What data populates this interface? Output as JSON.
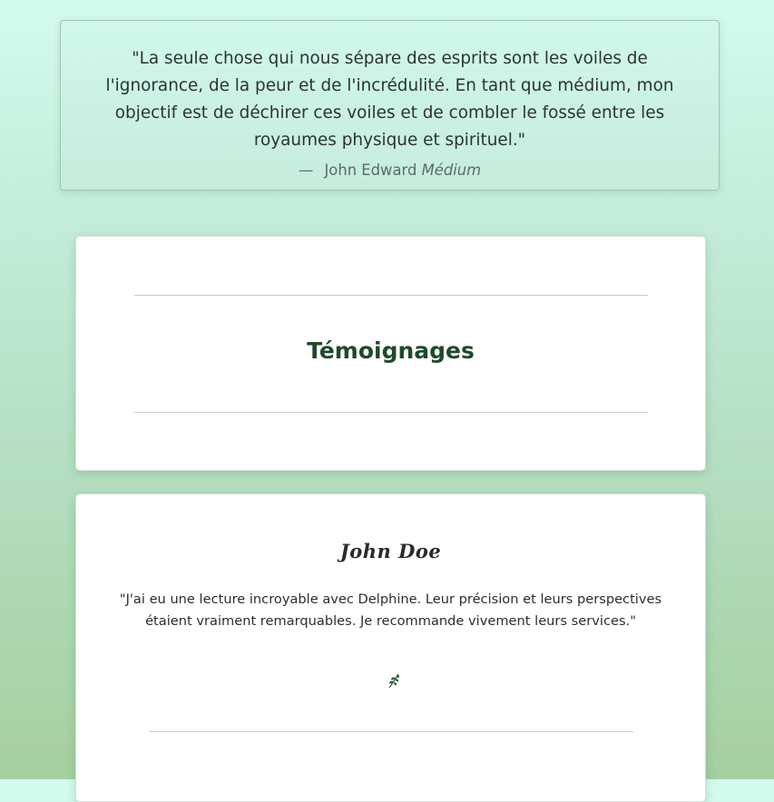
{
  "quote": {
    "text": "\"La seule chose qui nous sépare des esprits sont les voiles de l'ignorance, de la peur et de l'incrédulité. En tant que médium, mon objectif est de déchirer ces voiles et de combler le fossé entre les royaumes physique et spirituel.\"",
    "dash": "—",
    "author": "John Edward",
    "role": "Médium"
  },
  "testimonials_section": {
    "title": "Témoignages"
  },
  "testimonials": [
    {
      "name": "John Doe",
      "text": "\"J'ai eu une lecture incroyable avec Delphine. Leur précision et leurs perspectives étaient vraiment remarquables. Je recommande vivement leurs services.\"",
      "icon": "leaf-icon"
    }
  ],
  "colors": {
    "background_top": "#d3fbef",
    "background_bottom": "#a6cf9f",
    "title": "#1e4a2a",
    "leaf": "#2f5d36"
  }
}
